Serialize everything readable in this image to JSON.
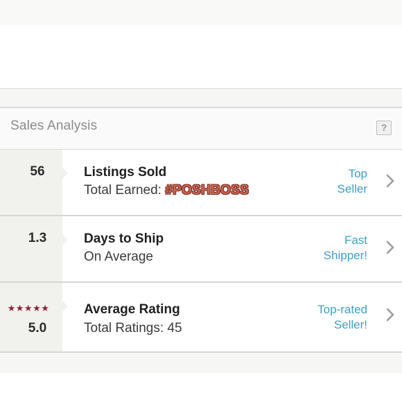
{
  "header": {
    "title": "Sales Analysis",
    "help_label": "?"
  },
  "rows": [
    {
      "stat": "56",
      "title": "Listings Sold",
      "subtitle_prefix": "Total Earned: ",
      "subtitle_highlight": "#POSHBOSS",
      "badge_line1": "Top",
      "badge_line2": "Seller"
    },
    {
      "stat": "1.3",
      "title": "Days to Ship",
      "subtitle": "On Average",
      "badge_line1": "Fast",
      "badge_line2": "Shipper!"
    },
    {
      "stat": "5.0",
      "rating_stars": 5,
      "stars_glyphs": "★★★★★",
      "title": "Average Rating",
      "subtitle": "Total Ratings: 45",
      "badge_line1": "Top-rated",
      "badge_line2": "Seller!"
    }
  ],
  "icons": {
    "chevron": "chevron-right-icon",
    "help": "help-icon",
    "star": "star-icon"
  },
  "colors": {
    "accent_link": "#3d9ec6",
    "star": "#8e2230",
    "poshboss_fill": "#c86a4f",
    "poshboss_outline": "#7a2a2a",
    "stat_column_bg": "#f1f1ee"
  }
}
